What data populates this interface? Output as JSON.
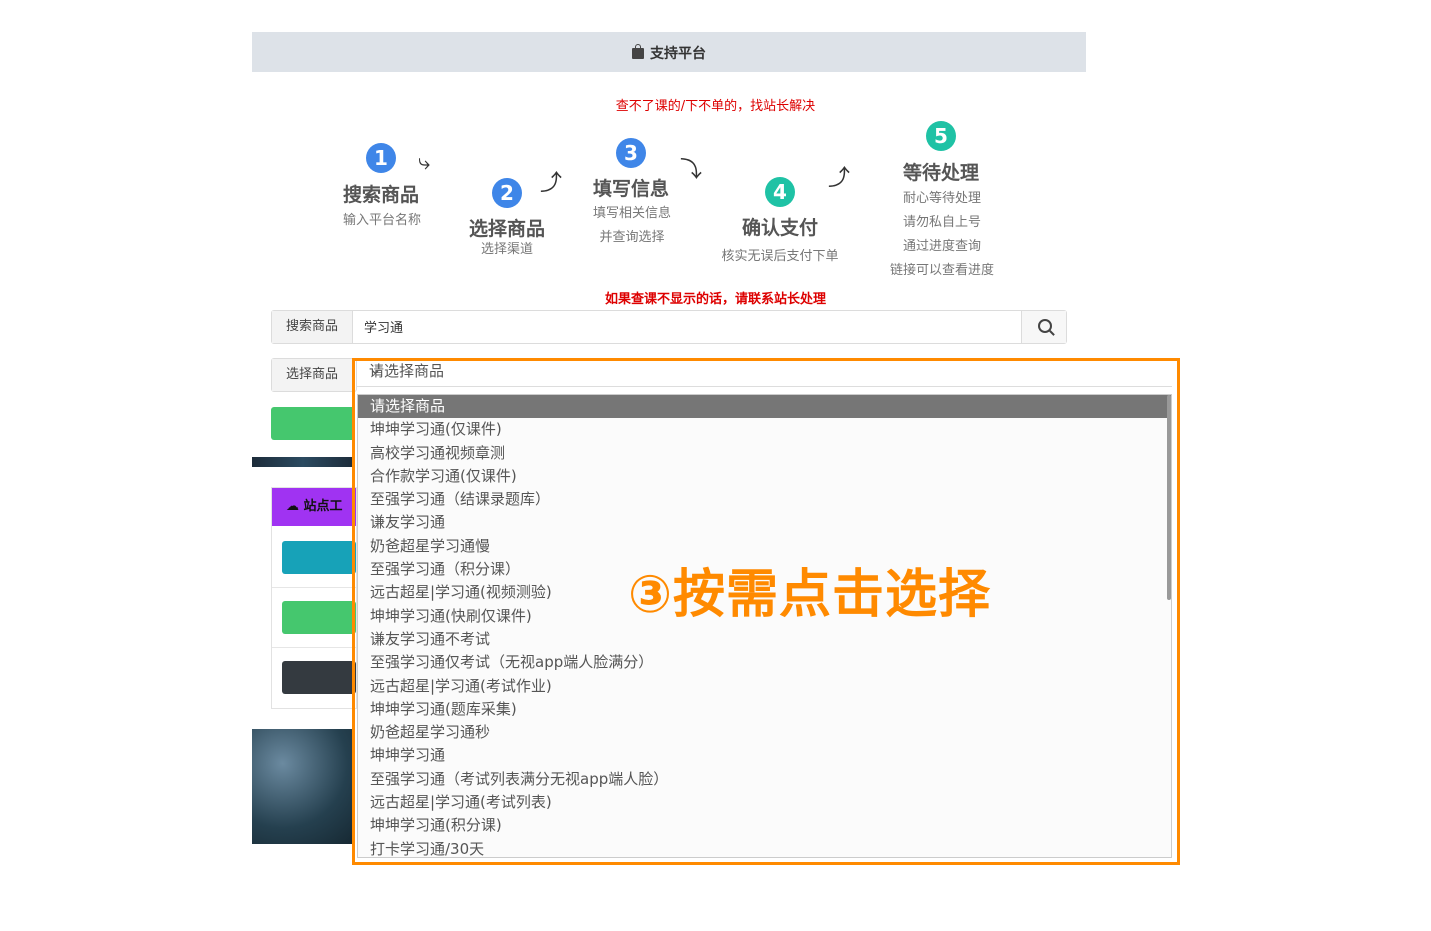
{
  "header": {
    "title": "支持平台",
    "icon": "shopping-bag-icon"
  },
  "notice_top": "查不了课的/下不单的，找站长解决",
  "steps": [
    {
      "num": "1",
      "title": "搜索商品",
      "desc": [
        "输入平台名称"
      ]
    },
    {
      "num": "2",
      "title": "选择商品",
      "desc": [
        "选择渠道"
      ]
    },
    {
      "num": "3",
      "title": "填写信息",
      "desc": [
        "填写相关信息",
        "并查询选择"
      ]
    },
    {
      "num": "4",
      "title": "确认支付",
      "desc": [
        "核实无误后支付下单"
      ]
    },
    {
      "num": "5",
      "title": "等待处理",
      "desc": [
        "耐心等待处理",
        "请勿私自上号",
        "通过进度查询",
        "链接可以查看进度"
      ]
    }
  ],
  "notice_bottom": "如果查课不显示的话，请联系站长处理",
  "search": {
    "label": "搜索商品",
    "value": "学习通",
    "button_icon": "search-icon"
  },
  "select": {
    "label": "选择商品",
    "placeholder": "请选择商品",
    "options": [
      "请选择商品",
      "坤坤学习通(仅课件)",
      "高校学习通视频章测",
      "合作款学习通(仅课件)",
      "至强学习通（结课录题库）",
      "谦友学习通",
      "奶爸超星学习通慢",
      "至强学习通（积分课）",
      "远古超星|学习通(视频测验)",
      "坤坤学习通(快刷仅课件)",
      "谦友学习通不考试",
      "至强学习通仅考试（无视app端人脸满分）",
      "远古超星|学习通(考试作业)",
      "坤坤学习通(题库采集)",
      "奶爸超星学习通秒",
      "坤坤学习通",
      "至强学习通（考试列表满分无视app端人脸）",
      "远古超星|学习通(考试列表)",
      "坤坤学习通(积分课)",
      "打卡学习通/30天"
    ]
  },
  "panel": {
    "title": "站点工"
  },
  "callout": "③按需点击选择",
  "colors": {
    "accent": "#ff8a00",
    "step_blue": "#3f86e8",
    "step_teal": "#1fc2a5",
    "notice_red": "#dd0000"
  }
}
